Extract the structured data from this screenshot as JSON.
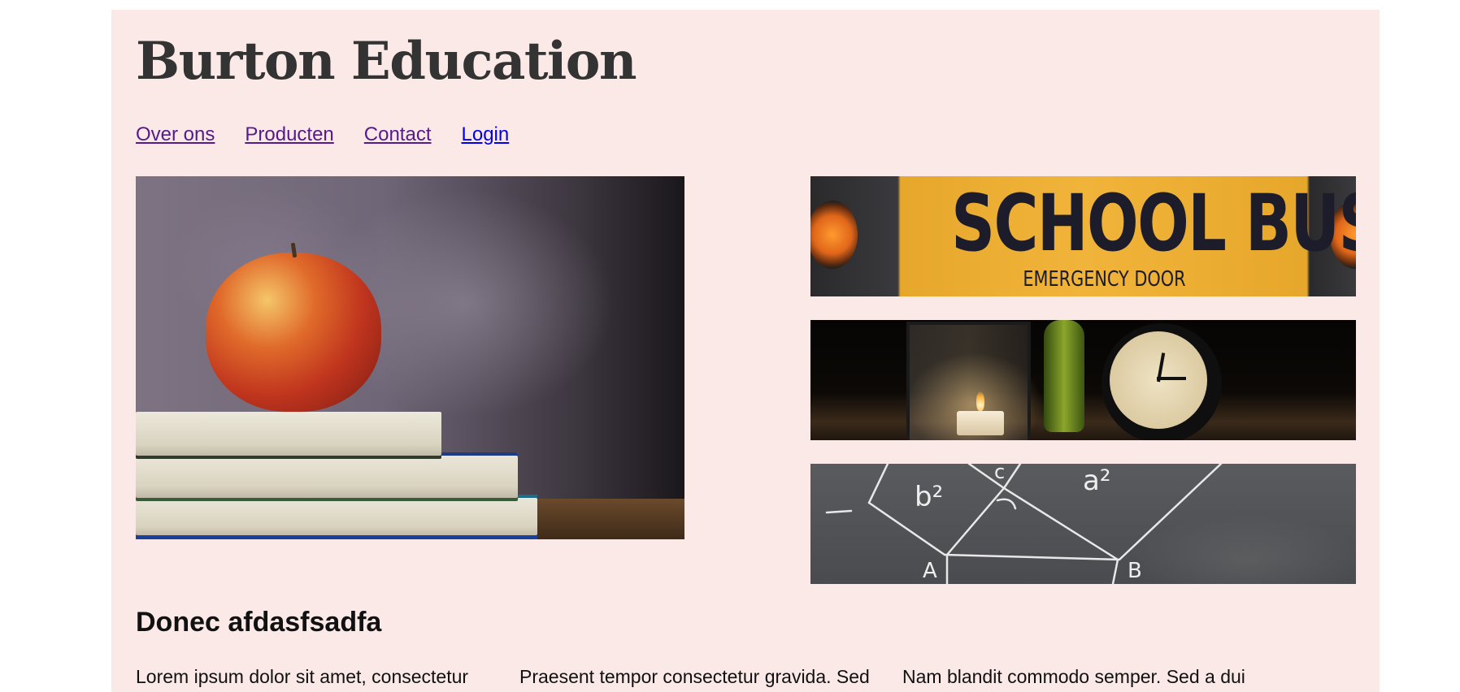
{
  "site": {
    "logo": "Burton Education"
  },
  "nav": {
    "items": [
      {
        "label": "Over ons"
      },
      {
        "label": "Producten"
      },
      {
        "label": "Contact"
      },
      {
        "label": "Login"
      }
    ]
  },
  "images": {
    "bus_sign": "SCHOOL BUS",
    "bus_door": "EMERGENCY DOOR",
    "chalk_labels": [
      "b²",
      "a²",
      "c",
      "A",
      "B"
    ]
  },
  "content": {
    "heading": "Donec afdasfsadfa",
    "columns": [
      "Lorem ipsum dolor sit amet, consectetur",
      "Praesent tempor consectetur gravida. Sed",
      "Nam blandit commodo semper. Sed a dui"
    ]
  },
  "colors": {
    "page_background": "#fbe9e8",
    "visited_link": "#551a8b",
    "link": "#0000ee",
    "logo": "#333333"
  }
}
